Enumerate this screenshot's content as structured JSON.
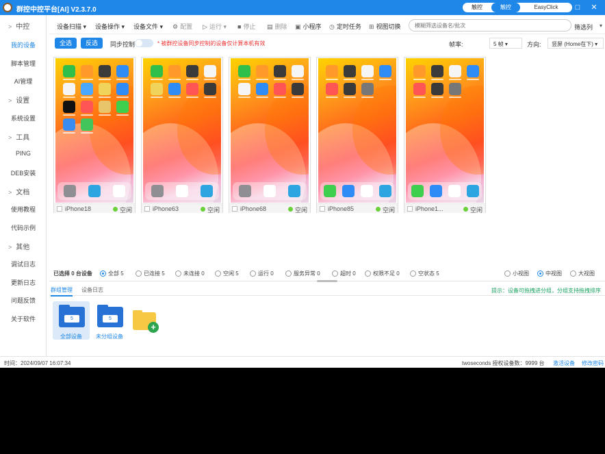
{
  "app": {
    "title": "群控中控平台[AI] V2.3.7.0"
  },
  "modes": {
    "items": [
      {
        "label": "触控"
      },
      {
        "label": "触控"
      },
      {
        "label": "EasyClick"
      }
    ],
    "active": 1,
    "accent": "#1e87e8"
  },
  "window_controls": [
    "–",
    "□",
    "✕"
  ],
  "sidebar": {
    "items": [
      {
        "label": "中控",
        "type": "group"
      },
      {
        "label": "我的设备",
        "type": "item",
        "selected": true
      },
      {
        "label": "脚本管理",
        "type": "item"
      },
      {
        "label": "AI管理",
        "type": "item"
      },
      {
        "label": "设置",
        "type": "group"
      },
      {
        "label": "系统设置",
        "type": "item"
      },
      {
        "label": "工具",
        "type": "group"
      },
      {
        "label": "PING",
        "type": "item"
      },
      {
        "label": "DEB安装",
        "type": "item"
      },
      {
        "label": "文档",
        "type": "group"
      },
      {
        "label": "使用教程",
        "type": "item"
      },
      {
        "label": "代码示例",
        "type": "item"
      },
      {
        "label": "其他",
        "type": "group"
      },
      {
        "label": "调试日志",
        "type": "item"
      },
      {
        "label": "更新日志",
        "type": "item"
      },
      {
        "label": "问题反馈",
        "type": "item"
      },
      {
        "label": "关于软件",
        "type": "item"
      }
    ]
  },
  "toolbar": {
    "device_scan": "设备扫描",
    "device_ops": "设备操作",
    "device_files": "设备文件",
    "config": "配置",
    "run": "运行",
    "stop": "停止",
    "delete": "删除",
    "mini_program": "小程序",
    "scheduled_task": "定时任务",
    "view_switch": "视图切换",
    "search_placeholder": "模糊筛选设备名/批次",
    "filter": "筛选列"
  },
  "options": {
    "select_all": "全选",
    "invert": "反选",
    "sync_label": "同步控制",
    "sync_on": false,
    "warning": "* 被群控设备同步控制的设备仅计算本机有效",
    "fps_label": "帧率:",
    "fps_value": "5 帧",
    "direction_label": "方向:",
    "direction_value": "竖屏 (Home在下)"
  },
  "devices": [
    {
      "name": "iPhone18",
      "status": "空闲"
    },
    {
      "name": "iPhone63",
      "status": "空闲"
    },
    {
      "name": "iPhone68",
      "status": "空闲"
    },
    {
      "name": "iPhone85",
      "status": "空闲"
    },
    {
      "name": "iPhone1...",
      "status": "空闲"
    }
  ],
  "status_filter": {
    "selected_text": "已选择 0 台设备",
    "options": [
      {
        "label": "全部 5",
        "checked": true
      },
      {
        "label": "已连接 5",
        "checked": false
      },
      {
        "label": "未连接 0",
        "checked": false
      },
      {
        "label": "空闲 5",
        "checked": false
      },
      {
        "label": "运行 0",
        "checked": false
      },
      {
        "label": "服务异常 0",
        "checked": false
      },
      {
        "label": "超时 0",
        "checked": false
      },
      {
        "label": "权限不足 0",
        "checked": false
      },
      {
        "label": "空状态 5",
        "checked": false
      }
    ],
    "view_options": [
      {
        "label": "小视图",
        "checked": false
      },
      {
        "label": "中视图",
        "checked": true
      },
      {
        "label": "大视图",
        "checked": false
      }
    ]
  },
  "bottom": {
    "tabs": [
      {
        "label": "群组管理"
      },
      {
        "label": "设备日志"
      }
    ],
    "hint": "提示：设备可拖拽进分组，分组支持拖拽排序",
    "folders": [
      {
        "name": "全部设备",
        "count": "5"
      },
      {
        "name": "未分组设备",
        "count": "5"
      }
    ]
  },
  "footer": {
    "time": "时间：2024/09/07 16:07:34",
    "license": "twoseconds 授权设备数：9999 台",
    "activate": "激活设备",
    "change_pwd": "修改密码"
  },
  "colors": {
    "accent": "#1e87e8",
    "idle_dot": "#6ad13a",
    "warning": "#e33333",
    "hint": "#1aa260"
  }
}
